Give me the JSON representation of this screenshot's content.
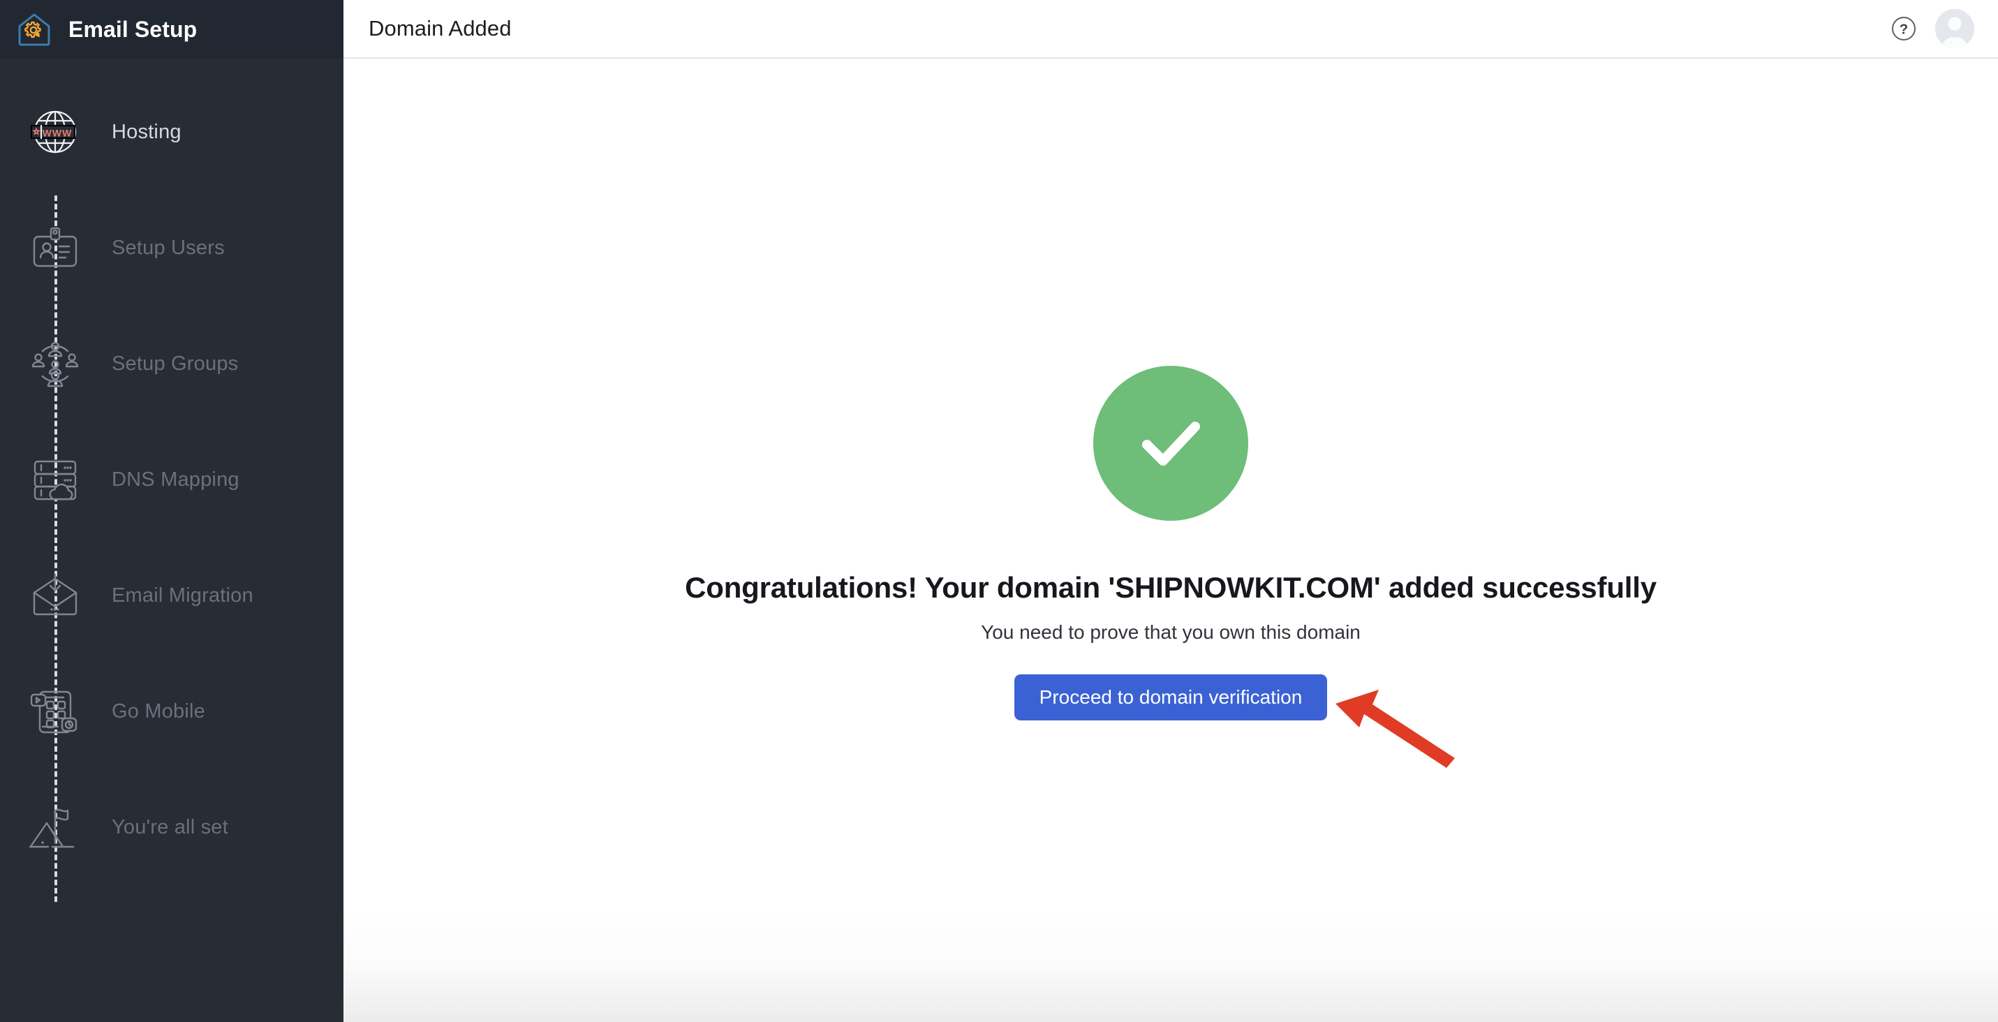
{
  "brand": {
    "title": "Email Setup",
    "logo_icon": "house-gear-icon",
    "logo_house_color": "#3f7cb0",
    "logo_gear_color": "#f0a830"
  },
  "sidebar": {
    "background_color": "#272c35",
    "active_label_color": "#d6d9de",
    "dim_label_color": "#6b717c",
    "items": [
      {
        "label": "Hosting",
        "icon": "globe-www-icon",
        "state": "active"
      },
      {
        "label": "Setup Users",
        "icon": "id-card-user-icon",
        "state": "dim"
      },
      {
        "label": "Setup Groups",
        "icon": "user-group-icon",
        "state": "dim"
      },
      {
        "label": "DNS Mapping",
        "icon": "server-cloud-icon",
        "state": "dim"
      },
      {
        "label": "Email Migration",
        "icon": "envelope-download-icon",
        "state": "dim"
      },
      {
        "label": "Go Mobile",
        "icon": "mobile-apps-icon",
        "state": "dim"
      },
      {
        "label": "You're all set",
        "icon": "mountain-flag-icon",
        "state": "dim"
      }
    ]
  },
  "topbar": {
    "title": "Domain Added",
    "help_icon": "question-circle-icon",
    "avatar_icon": "user-avatar-icon"
  },
  "main": {
    "status_icon": "check-circle-icon",
    "status_color": "#6ebd78",
    "title": "Congratulations! Your domain 'SHIPNOWKIT.COM' added successfully",
    "subtitle": "You need to prove that you own this domain",
    "cta_label": "Proceed to domain verification",
    "cta_color": "#3b62d4",
    "annotation": {
      "icon": "red-arrow-annotation",
      "color": "#e03c25",
      "points_to": "Proceed to domain verification"
    }
  }
}
